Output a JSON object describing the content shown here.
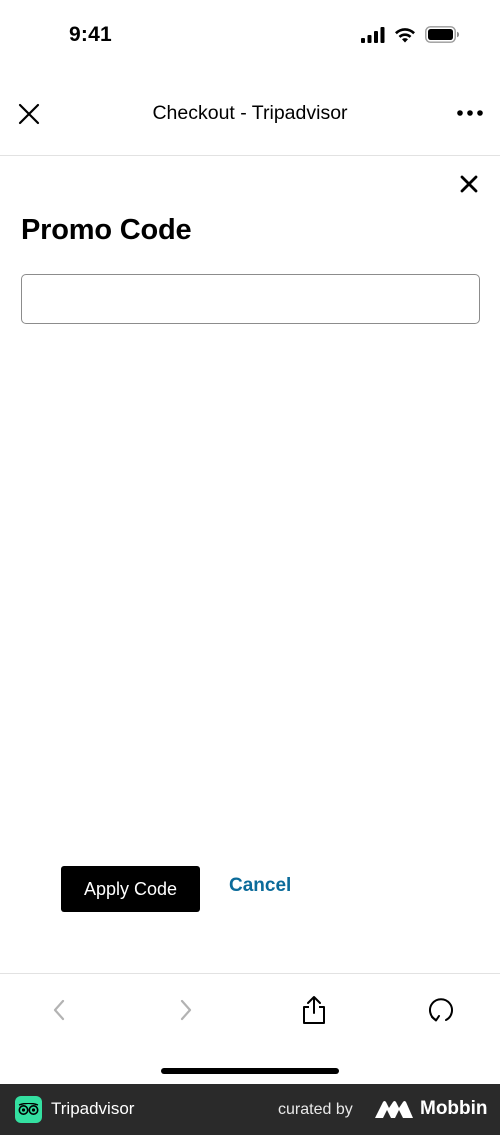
{
  "status_bar": {
    "time": "9:41",
    "icons": [
      "signal-icon",
      "wifi-icon",
      "battery-icon"
    ]
  },
  "nav": {
    "title": "Checkout - Tripadvisor",
    "close_icon": "close-icon",
    "more_icon": "more-icon"
  },
  "promo": {
    "heading": "Promo Code",
    "input_value": "",
    "input_placeholder": "",
    "dismiss_icon": "close-icon"
  },
  "actions": {
    "apply_label": "Apply Code",
    "cancel_label": "Cancel"
  },
  "toolbar": {
    "buttons": [
      "back-icon",
      "forward-icon",
      "share-icon",
      "refresh-icon"
    ]
  },
  "footer": {
    "app_name": "Tripadvisor",
    "curated_label": "curated by",
    "brand_name": "Mobbin"
  },
  "colors": {
    "accent_link": "#0b6b9a",
    "primary_button": "#000000",
    "app_logo": "#34e0a1",
    "footer_bg": "#2a2a2a"
  }
}
